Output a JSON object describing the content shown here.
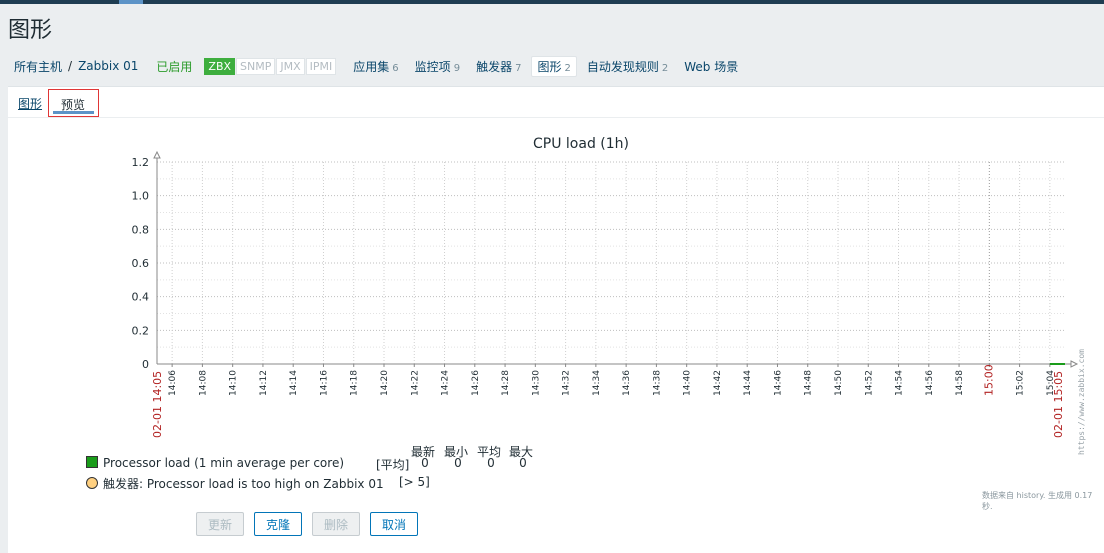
{
  "page": {
    "title": "图形"
  },
  "nav": {
    "all_hosts": "所有主机",
    "separator": "/",
    "host": "Zabbix 01",
    "status": "已启用",
    "badges": [
      {
        "label": "ZBX",
        "active": true
      },
      {
        "label": "SNMP",
        "active": false
      },
      {
        "label": "JMX",
        "active": false
      },
      {
        "label": "IPMI",
        "active": false
      }
    ],
    "links": [
      {
        "label": "应用集",
        "count": "6"
      },
      {
        "label": "监控项",
        "count": "9"
      },
      {
        "label": "触发器",
        "count": "7"
      },
      {
        "label": "图形",
        "count": "2",
        "active": true
      },
      {
        "label": "自动发现规则",
        "count": "2"
      },
      {
        "label": "Web 场景",
        "count": ""
      }
    ]
  },
  "tabs": {
    "graph": "图形",
    "preview": "预览"
  },
  "chart_data": {
    "type": "line",
    "title": "CPU load (1h)",
    "ylim": [
      0,
      1.2
    ],
    "y_ticks": [
      "0",
      "0.2",
      "0.4",
      "0.6",
      "0.8",
      "1.0",
      "1.2"
    ],
    "x_ticks": [
      "14:06",
      "14:08",
      "14:10",
      "14:12",
      "14:14",
      "14:16",
      "14:18",
      "14:20",
      "14:22",
      "14:24",
      "14:26",
      "14:28",
      "14:30",
      "14:32",
      "14:34",
      "14:36",
      "14:38",
      "14:40",
      "14:42",
      "14:44",
      "14:46",
      "14:48",
      "14:50",
      "14:52",
      "14:54",
      "14:56",
      "14:58",
      "15:00",
      "15:02",
      "15:04"
    ],
    "x_major_ticks": [
      "15:00"
    ],
    "x_start": "02-01 14:05",
    "x_end": "02-01 15:05",
    "grid": true,
    "watermark": "https://www.zabbix.com",
    "series": [
      {
        "name": "Processor load (1 min average per core)",
        "color": "#1a9c1a",
        "x": [
          "15:04",
          "15:05"
        ],
        "values": [
          0,
          0
        ]
      }
    ],
    "legend": {
      "item_label": "Processor load (1 min average per core)",
      "item_func": "[平均]",
      "stat_headers": [
        "最新",
        "最小",
        "平均",
        "最大"
      ],
      "stat_values": [
        "0",
        "0",
        "0",
        "0"
      ],
      "trigger_label": "触发器: Processor load is too high on Zabbix 01",
      "trigger_cond": "[> 5]",
      "trigger_color": "#ffd080"
    },
    "footnote": "数据来自 history. 生成用 0.17 秒."
  },
  "buttons": {
    "update": "更新",
    "clone": "克隆",
    "delete": "删除",
    "cancel": "取消"
  }
}
